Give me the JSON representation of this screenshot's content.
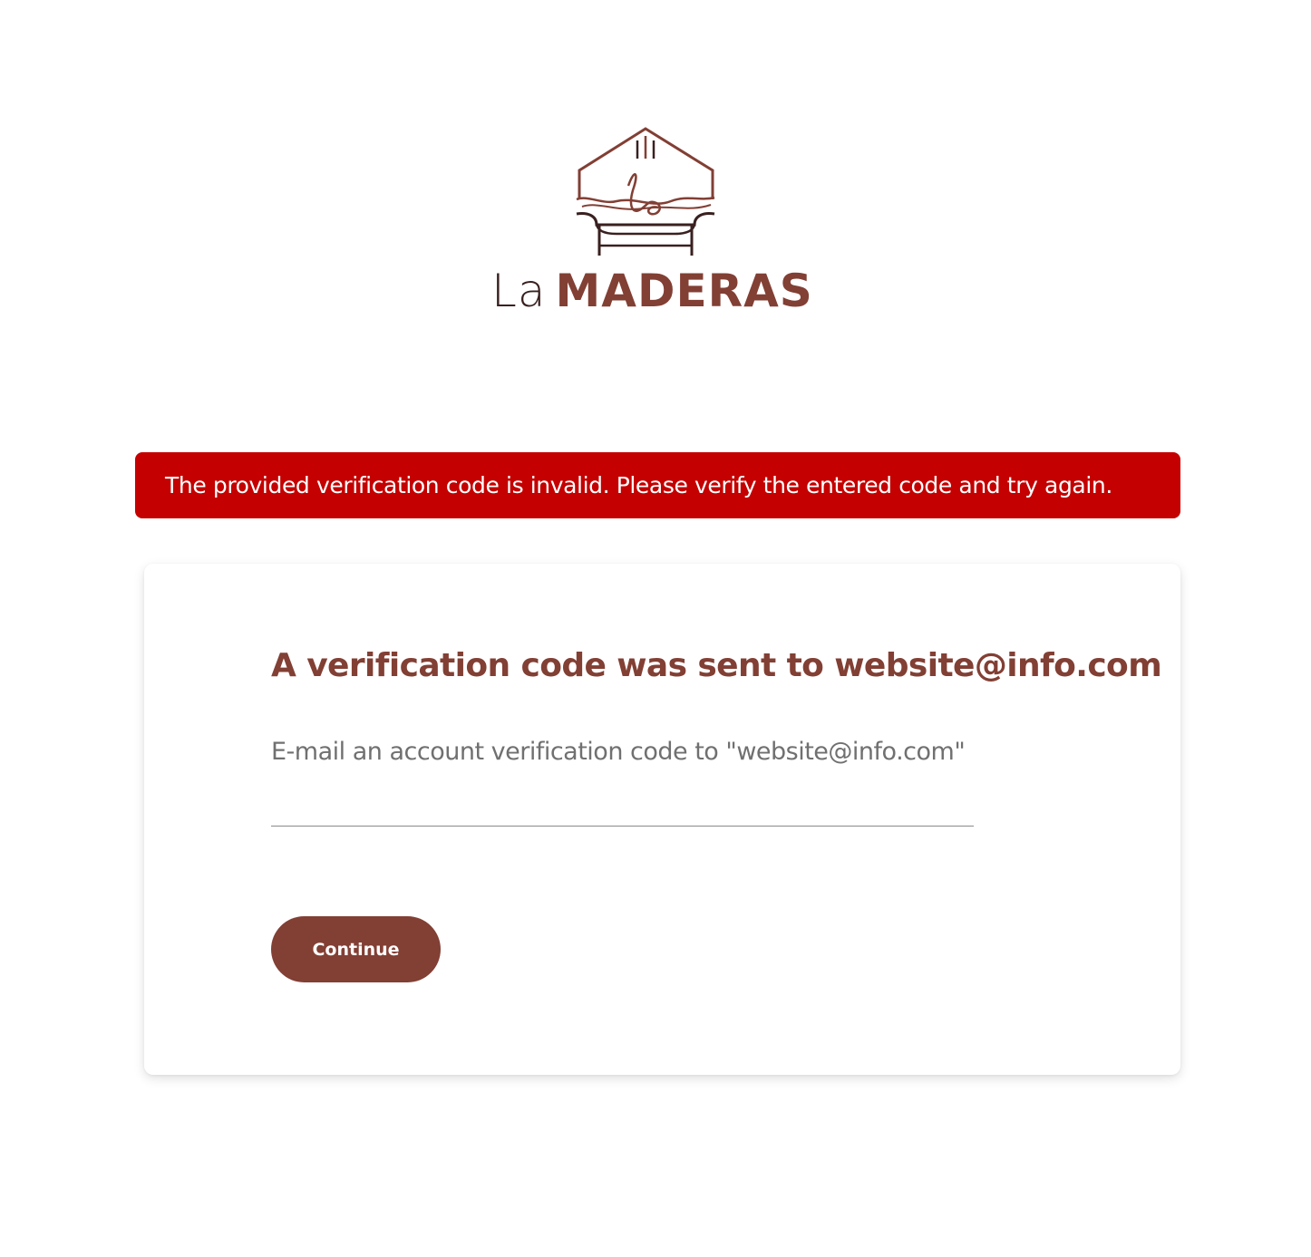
{
  "brand": {
    "logo_icon": "armchair-house-logo-icon",
    "name_prefix": "La",
    "name_main": "MADERAS",
    "colors": {
      "primary": "#823f34",
      "dark": "#3a2020"
    }
  },
  "error": {
    "message": "The provided verification code is invalid. Please verify the entered code and try again.",
    "color": "#c40000"
  },
  "card": {
    "heading": "A verification code was sent to website@info.com",
    "field_label": "E-mail an account verification code to \"website@info.com\"",
    "code_input_value": "",
    "continue_label": "Continue"
  }
}
